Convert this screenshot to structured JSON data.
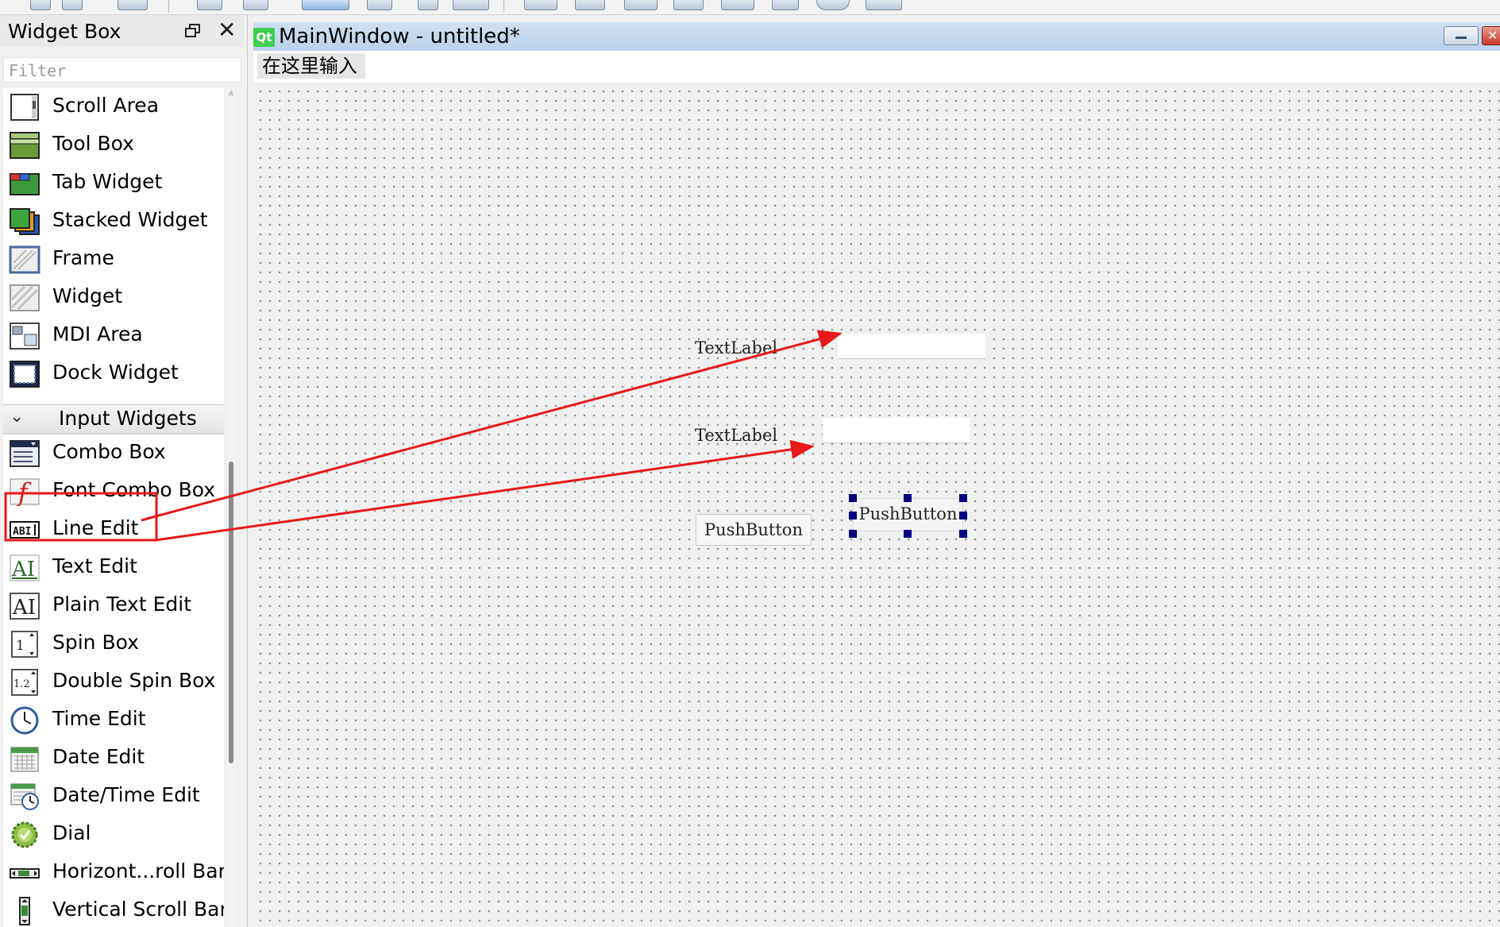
{
  "widget_box": {
    "title": "Widget Box",
    "filter_placeholder": "Filter",
    "items_top": [
      {
        "label": "Scroll Area",
        "icon": "scroll-area-icon"
      },
      {
        "label": "Tool Box",
        "icon": "tool-box-icon"
      },
      {
        "label": "Tab Widget",
        "icon": "tab-widget-icon"
      },
      {
        "label": "Stacked Widget",
        "icon": "stacked-widget-icon"
      },
      {
        "label": "Frame",
        "icon": "frame-icon"
      },
      {
        "label": "Widget",
        "icon": "widget-icon"
      },
      {
        "label": "MDI Area",
        "icon": "mdi-area-icon"
      },
      {
        "label": "Dock Widget",
        "icon": "dock-widget-icon"
      }
    ],
    "category": "Input Widgets",
    "items_input": [
      {
        "label": "Combo Box",
        "icon": "combo-box-icon"
      },
      {
        "label": "Font Combo Box",
        "icon": "font-combo-box-icon"
      },
      {
        "label": "Line Edit",
        "icon": "line-edit-icon"
      },
      {
        "label": "Text Edit",
        "icon": "text-edit-icon"
      },
      {
        "label": "Plain Text Edit",
        "icon": "plain-text-edit-icon"
      },
      {
        "label": "Spin Box",
        "icon": "spin-box-icon"
      },
      {
        "label": "Double Spin Box",
        "icon": "double-spin-box-icon"
      },
      {
        "label": "Time Edit",
        "icon": "time-edit-icon"
      },
      {
        "label": "Date Edit",
        "icon": "date-edit-icon"
      },
      {
        "label": "Date/Time Edit",
        "icon": "date-time-edit-icon"
      },
      {
        "label": "Dial",
        "icon": "dial-icon"
      },
      {
        "label": "Horizont...roll Bar",
        "icon": "horizontal-scroll-bar-icon"
      },
      {
        "label": "Vertical Scroll Bar",
        "icon": "vertical-scroll-bar-icon"
      }
    ]
  },
  "main_window": {
    "title": "MainWindow - untitled*",
    "logo_text": "Qt",
    "menu_placeholder": "在这里输入",
    "form": {
      "label1": "TextLabel",
      "label2": "TextLabel",
      "button1": "PushButton",
      "button2": "PushButton"
    }
  },
  "annotation": {
    "color": "#e8191a",
    "highlighted_item": "Line Edit"
  },
  "colors": {
    "selection_handle": "#000080",
    "title_bar": "#c4d8ee",
    "qt_logo": "#41cd52"
  }
}
